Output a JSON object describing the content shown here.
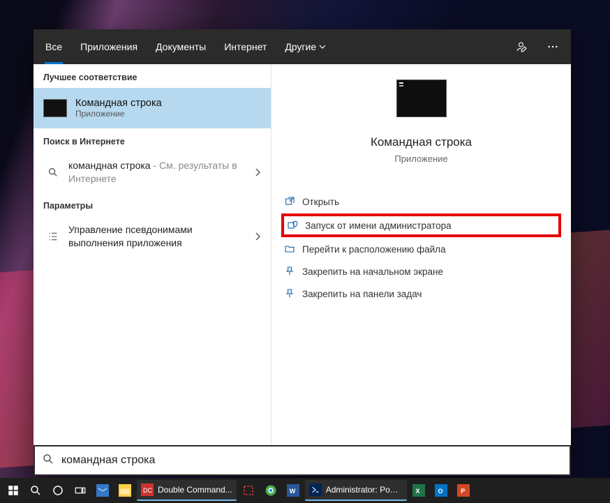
{
  "tabs": {
    "all": "Все",
    "apps": "Приложения",
    "docs": "Документы",
    "internet": "Интернет",
    "more": "Другие"
  },
  "left": {
    "best_match_header": "Лучшее соответствие",
    "best_match_title": "Командная строка",
    "best_match_sub": "Приложение",
    "search_web_header": "Поиск в Интернете",
    "web_query_bold": "командная строка",
    "web_query_suffix": " - См. результаты в Интернете",
    "settings_header": "Параметры",
    "settings_item": "Управление псевдонимами выполнения приложения"
  },
  "preview": {
    "title": "Командная строка",
    "sub": "Приложение",
    "actions": {
      "open": "Открыть",
      "run_admin": "Запуск от имени администратора",
      "open_location": "Перейти к расположению файла",
      "pin_start": "Закрепить на начальном экране",
      "pin_taskbar": "Закрепить на панели задач"
    }
  },
  "search": {
    "value": "командная строка"
  },
  "taskbar": {
    "dc": "Double Command...",
    "ps": "Administrator: Pow..."
  }
}
